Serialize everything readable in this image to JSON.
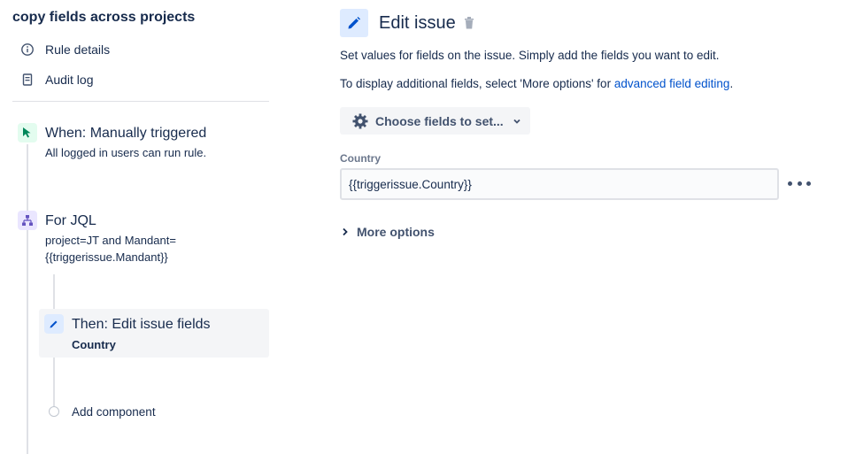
{
  "sidebar": {
    "rule_title": "copy fields across projects",
    "nav": [
      {
        "label": "Rule details",
        "icon": "info-icon"
      },
      {
        "label": "Audit log",
        "icon": "document-icon"
      }
    ],
    "steps": {
      "trigger": {
        "title": "When: Manually triggered",
        "subtitle": "All logged in users can run rule.",
        "icon": "cursor-trigger-icon",
        "color": "#36b37e"
      },
      "branch": {
        "title": "For JQL",
        "subtitle_line1": "project=JT and Mandant=",
        "subtitle_line2": "{{triggerissue.Mandant}}",
        "icon": "branch-icon",
        "color": "#6554c0"
      },
      "action": {
        "title": "Then: Edit issue fields",
        "subtitle": "Country",
        "icon": "pencil-icon",
        "color": "#0052cc"
      },
      "add_component": "Add component"
    }
  },
  "panel": {
    "title": "Edit issue",
    "description1": "Set values for fields on the issue. Simply add the fields you want to edit.",
    "description2_prefix": "To display additional fields, select 'More options' for ",
    "description2_link": "advanced field editing",
    "description2_suffix": ".",
    "choose_fields_label": "Choose fields to set...",
    "field": {
      "label": "Country",
      "value": "{{triggerissue.Country}}"
    },
    "more_options_label": "More options"
  }
}
